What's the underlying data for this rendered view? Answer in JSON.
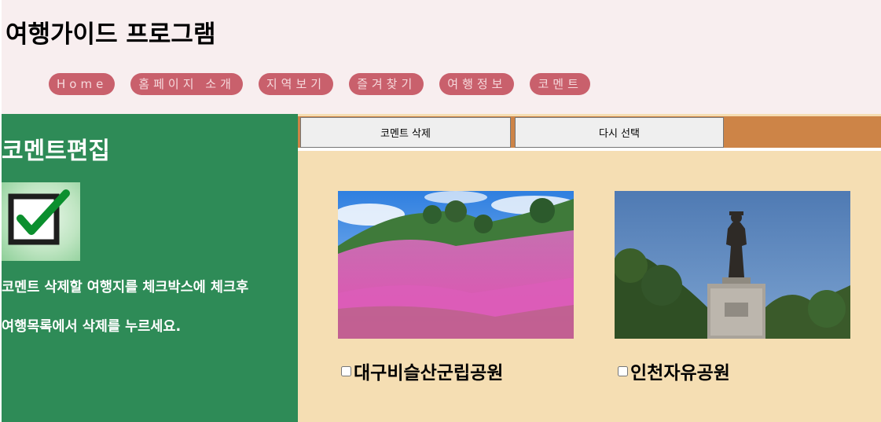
{
  "header": {
    "title": "여행가이드 프로그램",
    "nav": [
      {
        "label": "Home"
      },
      {
        "label": "홈페이지 소개"
      },
      {
        "label": "지역보기"
      },
      {
        "label": "즐겨찾기"
      },
      {
        "label": "여행정보"
      },
      {
        "label": "코멘트"
      }
    ]
  },
  "sidebar": {
    "title": "코멘트편집",
    "icon": "checkbox-check-icon",
    "description_line1": "코멘트 삭제할 여행지를 체크박스에 체크후",
    "description_line2": "여행목록에서 삭제를 누르세요."
  },
  "toolbar": {
    "delete_label": "코멘트 삭제",
    "reselect_label": "다시 선택"
  },
  "places": [
    {
      "name": "대구비슬산군립공원",
      "checked": false,
      "photo": "azalea-hill-photo"
    },
    {
      "name": "인천자유공원",
      "checked": false,
      "photo": "statue-photo"
    }
  ],
  "colors": {
    "header_bg": "#f8eeef",
    "nav_bg": "#c9606c",
    "sidebar_bg": "#2e8b57",
    "main_bg": "#f5deb3",
    "toolbar_bg": "#cd8447"
  }
}
